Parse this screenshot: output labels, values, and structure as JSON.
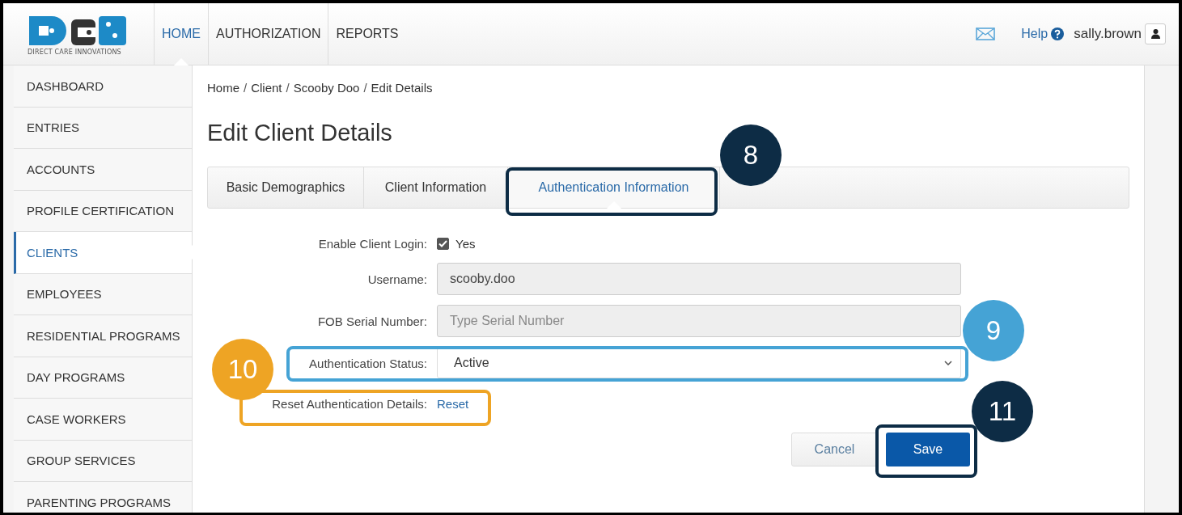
{
  "header": {
    "logo_tagline": "DIRECT CARE INNOVATIONS",
    "nav": [
      {
        "label": "HOME",
        "selected": true
      },
      {
        "label": "AUTHORIZATION",
        "selected": false
      },
      {
        "label": "REPORTS",
        "selected": false
      }
    ],
    "help": "Help",
    "username": "sally.brown"
  },
  "sidebar": {
    "items": [
      {
        "label": "DASHBOARD",
        "selected": false
      },
      {
        "label": "ENTRIES",
        "selected": false
      },
      {
        "label": "ACCOUNTS",
        "selected": false
      },
      {
        "label": "PROFILE CERTIFICATION",
        "selected": false
      },
      {
        "label": "CLIENTS",
        "selected": true
      },
      {
        "label": "EMPLOYEES",
        "selected": false
      },
      {
        "label": "RESIDENTIAL PROGRAMS",
        "selected": false
      },
      {
        "label": "DAY PROGRAMS",
        "selected": false
      },
      {
        "label": "CASE WORKERS",
        "selected": false
      },
      {
        "label": "GROUP SERVICES",
        "selected": false
      },
      {
        "label": "PARENTING PROGRAMS",
        "selected": false
      }
    ]
  },
  "breadcrumb": {
    "items": [
      "Home",
      "Client",
      "Scooby Doo",
      "Edit Details"
    ],
    "separators": [
      "/",
      "/",
      "/"
    ]
  },
  "title": "Edit Client Details",
  "tabs": [
    {
      "label": "Basic Demographics",
      "selected": false
    },
    {
      "label": "Client Information",
      "selected": false
    },
    {
      "label": "Authentication Information",
      "selected": true
    }
  ],
  "form": {
    "fields": [
      {
        "kind": "checkbox",
        "label": "Enable Client Login:",
        "checked": true,
        "text": "Yes"
      },
      {
        "kind": "text",
        "label": "Username:",
        "value": "scooby.doo"
      },
      {
        "kind": "text",
        "label": "FOB Serial Number:",
        "placeholder": "Type Serial Number"
      },
      {
        "kind": "select",
        "label": "Authentication Status:",
        "value": "Active"
      },
      {
        "kind": "link",
        "label": "Reset Authentication Details:",
        "text": "Reset"
      }
    ]
  },
  "buttons": {
    "cancel": "Cancel",
    "save": "Save"
  },
  "callouts": [
    {
      "number": "8",
      "color": "#0d2c45"
    },
    {
      "number": "9",
      "color": "#45a3d5"
    },
    {
      "number": "10",
      "color": "#eea424"
    },
    {
      "number": "11",
      "color": "#0d2c45"
    }
  ]
}
